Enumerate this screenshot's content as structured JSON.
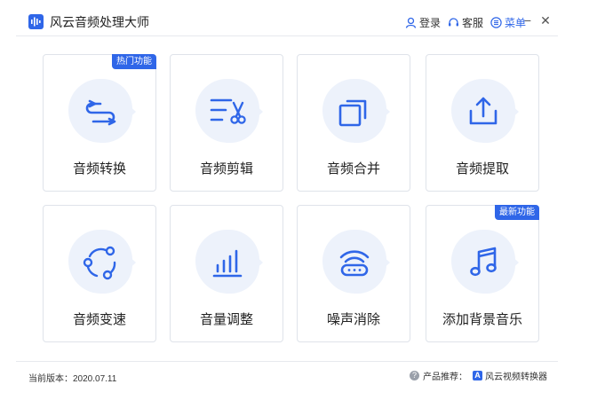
{
  "app": {
    "title": "风云音频处理大师",
    "accent_color": "#2f66e8"
  },
  "titlebar": {
    "login_label": "登录",
    "support_label": "客服",
    "menu_label": "菜单",
    "minimize_label": "−",
    "close_label": "✕"
  },
  "cards": [
    {
      "label": "音频转换",
      "icon": "convert-arrows-icon",
      "badge": "热门功能"
    },
    {
      "label": "音频剪辑",
      "icon": "scissors-icon",
      "badge": ""
    },
    {
      "label": "音频合并",
      "icon": "merge-squares-icon",
      "badge": ""
    },
    {
      "label": "音频提取",
      "icon": "upload-tray-icon",
      "badge": ""
    },
    {
      "label": "音频变速",
      "icon": "speed-circle-icon",
      "badge": ""
    },
    {
      "label": "音量调整",
      "icon": "volume-bars-icon",
      "badge": ""
    },
    {
      "label": "噪声消除",
      "icon": "noise-wifi-icon",
      "badge": ""
    },
    {
      "label": "添加背景音乐",
      "icon": "music-note-icon",
      "badge": "最新功能"
    }
  ],
  "footer": {
    "version_text": "当前版本：2020.07.11",
    "recommend_label": "产品推荐：",
    "recommend_app": "风云视频转换器"
  }
}
